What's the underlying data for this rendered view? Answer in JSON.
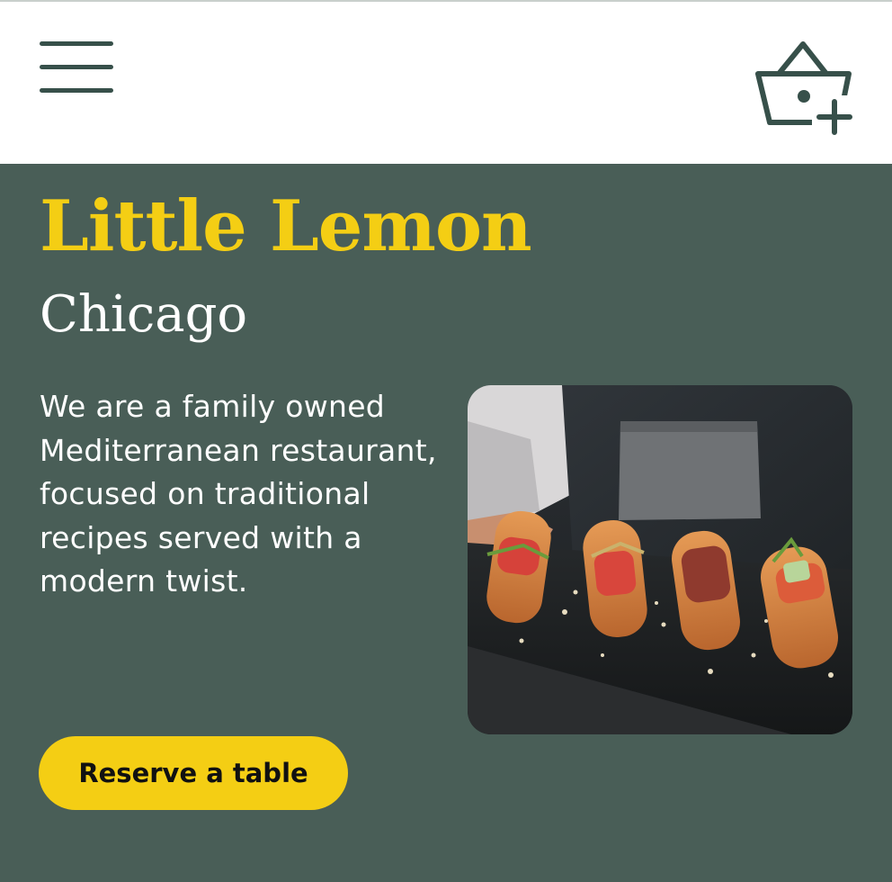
{
  "header": {
    "menu_icon": "hamburger-menu-icon",
    "cart_icon": "basket-add-icon"
  },
  "hero": {
    "title": "Little Lemon",
    "subtitle": "Chicago",
    "description": "We are a family owned Mediterranean restaurant, focused on traditional recipes served with a modern twist.",
    "cta_label": "Reserve a table",
    "image_icon": "food-platter-photo"
  },
  "colors": {
    "primary_green": "#495e57",
    "accent_yellow": "#f4ce14",
    "icon_dark": "#37504a",
    "text_light": "#ffffff"
  }
}
